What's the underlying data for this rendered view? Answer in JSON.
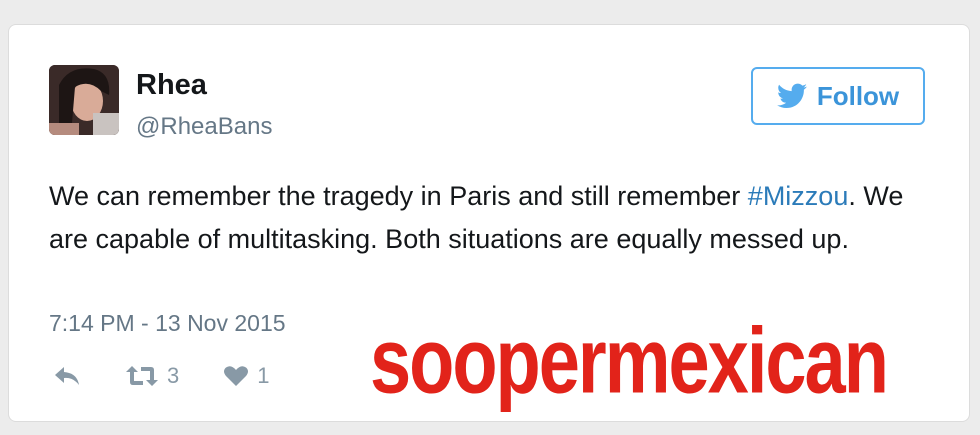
{
  "tweet": {
    "author_name": "Rhea",
    "author_handle": "@RheaBans",
    "text_part1": "We can remember the tragedy in Paris and still remember ",
    "hashtag": "#Mizzou",
    "text_part2": ". We are capable of multitasking. Both situations are equally messed up.",
    "timestamp": "7:14 PM - 13 Nov 2015",
    "retweet_count": "3",
    "like_count": "1"
  },
  "follow_button": {
    "label": "Follow",
    "icon": "twitter-bird-icon"
  },
  "actions": {
    "reply_icon": "reply-icon",
    "retweet_icon": "retweet-icon",
    "like_icon": "heart-icon"
  },
  "watermark": {
    "text": "soopermexican"
  },
  "colors": {
    "twitter_blue": "#55acee",
    "hashtag": "#2b7bb9",
    "muted": "#657786",
    "watermark": "#e2231a"
  }
}
